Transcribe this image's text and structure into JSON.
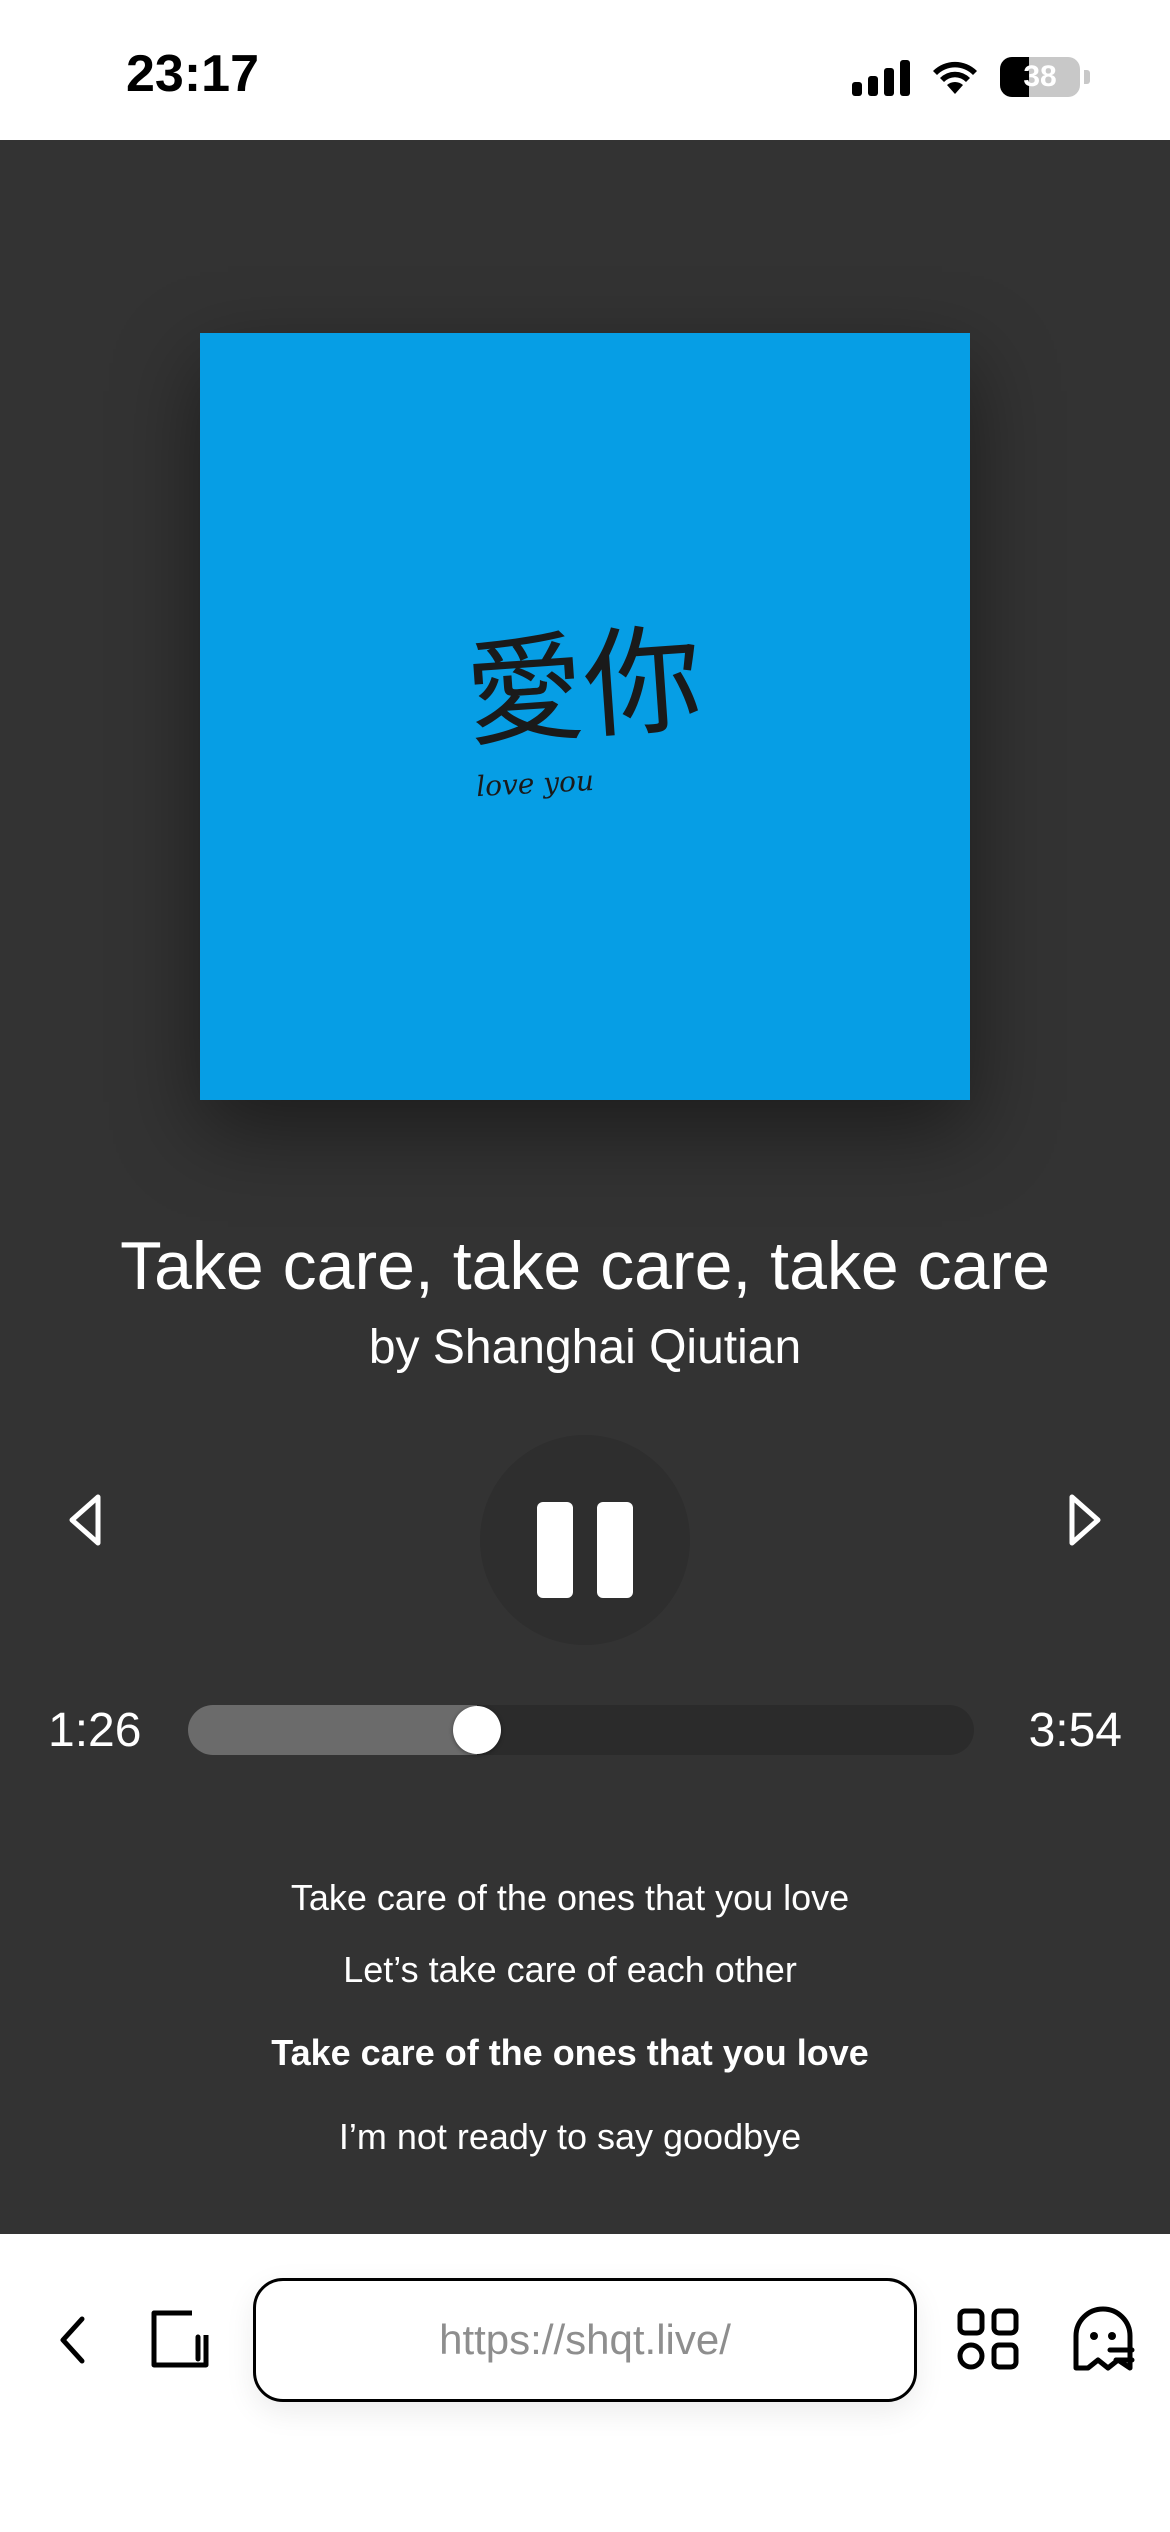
{
  "status_bar": {
    "time": "23:17",
    "battery_level": "38",
    "icons": [
      "signal-icon",
      "wifi-icon",
      "battery-icon"
    ]
  },
  "album": {
    "cover_text_main": "愛你",
    "cover_text_sub": "love you",
    "cover_color": "#069ee5"
  },
  "song": {
    "title": "Take care, take care, take care",
    "artist": "by Shanghai Qiutian"
  },
  "controls": {
    "previous_icon": "triangle-left-icon",
    "play_state": "pause-icon",
    "next_icon": "triangle-right-icon"
  },
  "progress": {
    "elapsed": "1:26",
    "total": "3:54",
    "fraction": 0.3675
  },
  "lyrics": [
    {
      "text": "Take care of the ones that you love",
      "current": false
    },
    {
      "text": "Let’s take care of each other",
      "current": false
    },
    {
      "text": "Take care of the ones that you love",
      "current": true
    },
    {
      "text": "I’m not ready to say goodbye",
      "current": false
    }
  ],
  "browser": {
    "url": "https://shqt.live/",
    "icons": [
      "back-chevron-icon",
      "tab-switcher-icon",
      "apps-grid-icon",
      "ghost-icon"
    ]
  },
  "colors": {
    "player_bg": "#333333",
    "accent_blue": "#069ee5"
  }
}
